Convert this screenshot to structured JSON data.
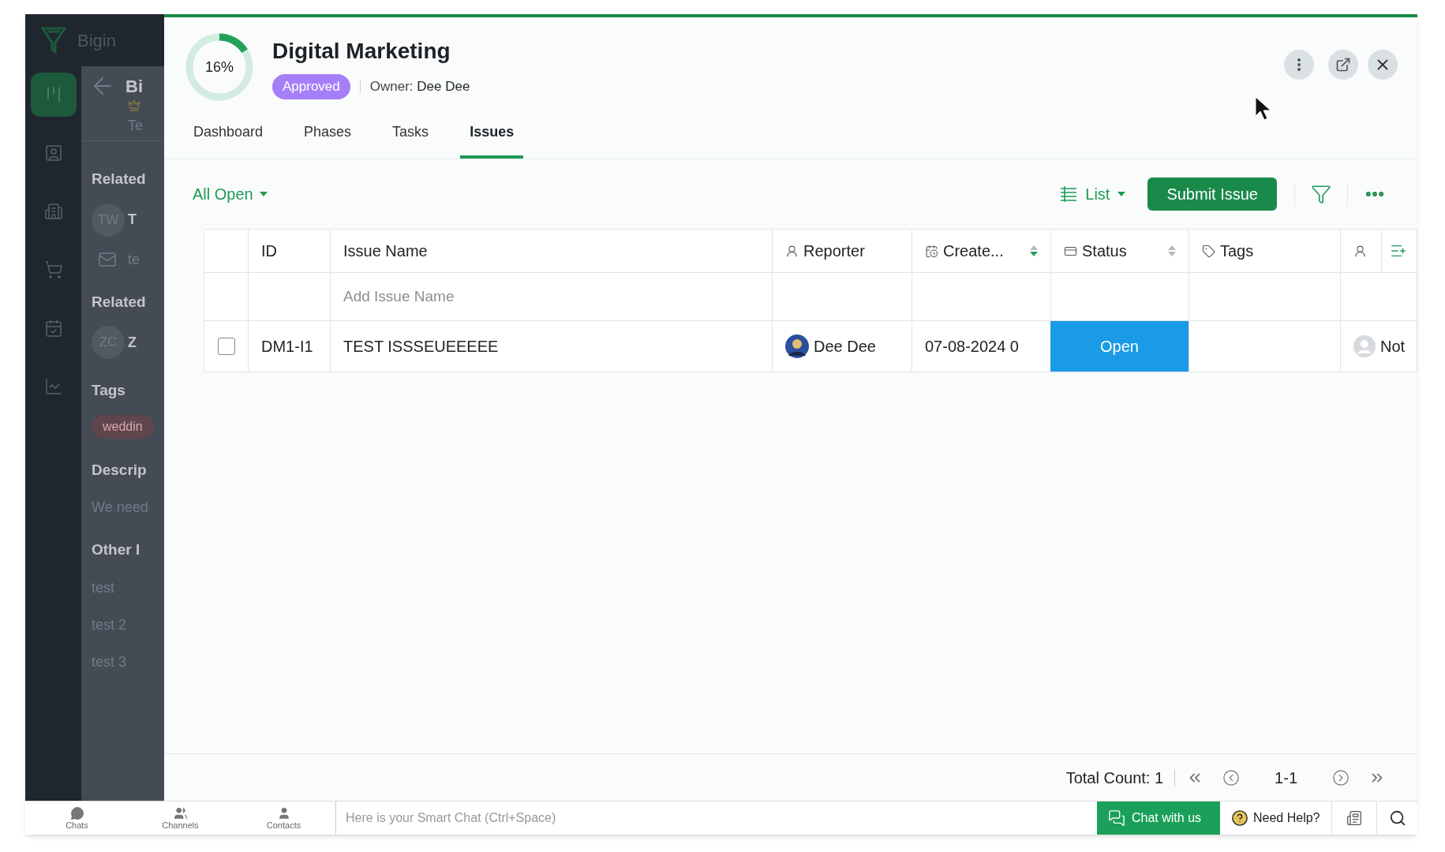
{
  "app": {
    "name": "Bigin"
  },
  "nav_icons": [
    {
      "kind": "board",
      "selected": true
    },
    {
      "kind": "contact",
      "selected": false
    },
    {
      "kind": "company",
      "selected": false
    },
    {
      "kind": "cart",
      "selected": false
    },
    {
      "kind": "calendar",
      "selected": false
    },
    {
      "kind": "report",
      "selected": false
    }
  ],
  "background_panel": {
    "title": "Bi",
    "subtitle": "Te",
    "items": [
      {
        "kind": "heading",
        "text": "Related"
      },
      {
        "kind": "avatar",
        "initials": "TW",
        "text": "T"
      },
      {
        "kind": "mail",
        "text": "te"
      },
      {
        "kind": "heading",
        "text": "Related"
      },
      {
        "kind": "avatar",
        "initials": "ZC",
        "text": "Z"
      },
      {
        "kind": "heading",
        "text": "Tags"
      },
      {
        "kind": "tag",
        "text": "weddin"
      },
      {
        "kind": "heading",
        "text": "Descrip"
      },
      {
        "kind": "text",
        "text": "We need"
      },
      {
        "kind": "heading",
        "text": "Other I"
      },
      {
        "kind": "text",
        "text": "test"
      },
      {
        "kind": "text",
        "text": "test 2"
      },
      {
        "kind": "text",
        "text": "test 3"
      }
    ]
  },
  "project": {
    "progress_label": "16%",
    "level": 0.16,
    "title": "Digital Marketing",
    "status": "Approved",
    "owner_label": "Owner:",
    "owner": "Dee Dee"
  },
  "tabs": [
    {
      "label": "Dashboard",
      "selected": false
    },
    {
      "label": "Phases",
      "selected": false
    },
    {
      "label": "Tasks",
      "selected": false
    },
    {
      "label": "Issues",
      "selected": true
    }
  ],
  "view": {
    "filter": "All Open",
    "layout": "List",
    "submit": "Submit Issue"
  },
  "table": {
    "columns": [
      {
        "kind": "check"
      },
      {
        "kind": "text",
        "label": "ID"
      },
      {
        "kind": "text",
        "label": "Issue Name"
      },
      {
        "kind": "text",
        "label": "Reporter"
      },
      {
        "kind": "text",
        "label": "Create...",
        "sortable": true,
        "sorted": true
      },
      {
        "kind": "text",
        "label": "Status",
        "sortable": true,
        "sorted": false
      },
      {
        "kind": "text",
        "label": "Tags"
      },
      {
        "kind": "icon"
      }
    ],
    "add_row_placeholder": "Add Issue Name",
    "rows": [
      {
        "checked": false,
        "id": "DM1-I1",
        "name": "TEST ISSSEUEEEEE",
        "reporter": "Dee Dee",
        "created": "07-08-2024 0",
        "status": {
          "label": "Open",
          "color": "#1a9be6"
        },
        "assignee": "Not"
      }
    ]
  },
  "footer": {
    "total_label": "Total Count: 1",
    "range": "1-1"
  },
  "bottom_bar": {
    "apps": [
      {
        "label": "Chats"
      },
      {
        "label": "Channels"
      },
      {
        "label": "Contacts"
      }
    ],
    "chat_placeholder": "Here is your Smart Chat (Ctrl+Space)",
    "chat_button": "Chat with us",
    "help": "Need Help?"
  }
}
